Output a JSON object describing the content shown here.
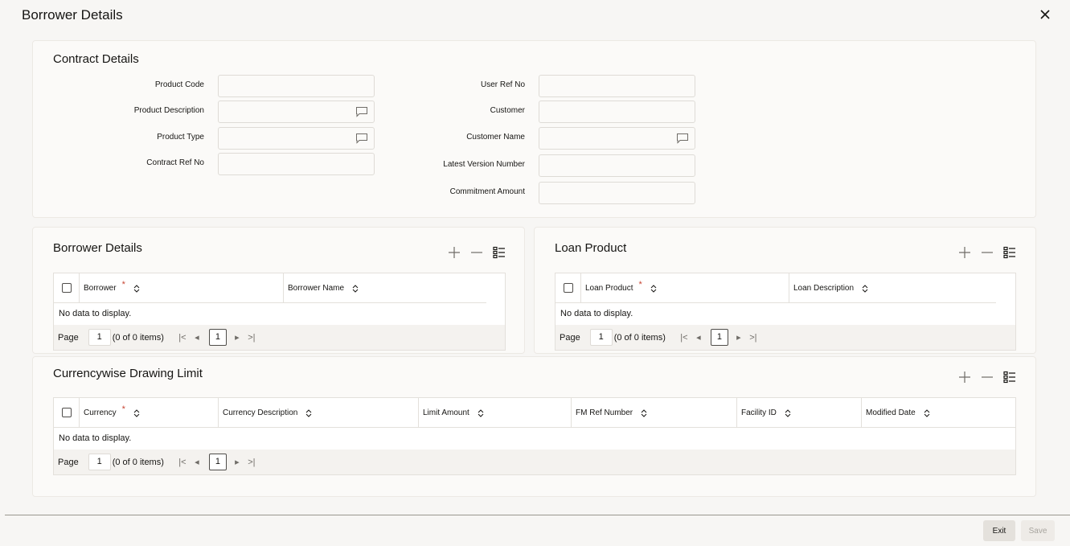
{
  "window": {
    "title": "Borrower Details"
  },
  "contract": {
    "title": "Contract Details",
    "left_fields": [
      {
        "label": "Product Code",
        "value": ""
      },
      {
        "label": "Product Description",
        "value": ""
      },
      {
        "label": "Product Type",
        "value": ""
      },
      {
        "label": "Contract Ref No",
        "value": ""
      }
    ],
    "right_fields": [
      {
        "label": "User Ref No",
        "value": ""
      },
      {
        "label": "Customer",
        "value": ""
      },
      {
        "label": "Customer Name",
        "value": ""
      },
      {
        "label": "Latest Version Number",
        "value": ""
      },
      {
        "label": "Commitment Amount",
        "value": ""
      }
    ]
  },
  "borrower": {
    "title": "Borrower Details",
    "columns": [
      "Borrower",
      "Borrower Name"
    ],
    "required_mark": "*",
    "empty_text": "No data to display.",
    "pager": {
      "label": "Page",
      "page": "1",
      "count": "(0 of 0 items)",
      "current": "1"
    }
  },
  "loan": {
    "title": "Loan Product",
    "columns": [
      "Loan Product",
      "Loan Description"
    ],
    "required_mark": "*",
    "empty_text": "No data to display.",
    "pager": {
      "label": "Page",
      "page": "1",
      "count": "(0 of 0 items)",
      "current": "1"
    }
  },
  "currency": {
    "title": "Currencywise Drawing Limit",
    "columns": [
      "Currency",
      "Currency Description",
      "Limit Amount",
      "FM Ref Number",
      "Facility ID",
      "Modified Date"
    ],
    "required_mark": "*",
    "empty_text": "No data to display.",
    "pager": {
      "label": "Page",
      "page": "1",
      "count": "(0 of 0 items)",
      "current": "1"
    }
  },
  "pager_glyphs": {
    "first": "|<",
    "prev": "◂",
    "next": "▸",
    "last": ">|"
  },
  "footer": {
    "exit_label": "Exit",
    "save_label": "Save"
  },
  "colors": {
    "accent": "#161513",
    "required": "#c74634",
    "border": "#e3e0db"
  }
}
